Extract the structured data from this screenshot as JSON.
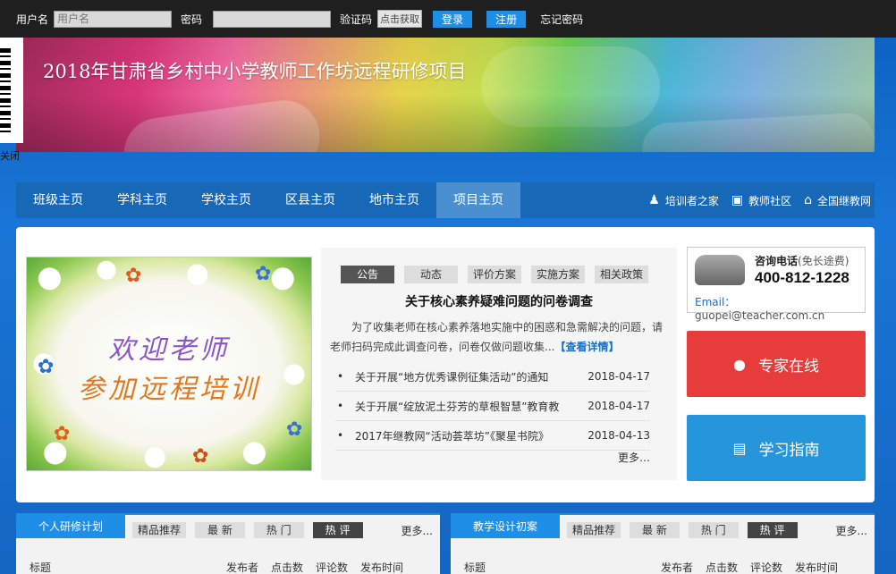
{
  "login": {
    "username_label": "用户名",
    "username_placeholder": "用户名",
    "password_label": "密码",
    "captcha_label": "验证码",
    "captcha_button": "点击获取",
    "login_button": "登录",
    "register_button": "注册",
    "forgot_link": "忘记密码"
  },
  "banner": {
    "title": "2018年甘肃省乡村中小学教师工作坊远程研修项目"
  },
  "qr": {
    "close_label": "关闭"
  },
  "nav": {
    "items": [
      "班级主页",
      "学科主页",
      "学校主页",
      "区县主页",
      "地市主页",
      "项目主页"
    ],
    "active_index": 5,
    "right_links": [
      "培训者之家",
      "教师社区",
      "全国继教网"
    ]
  },
  "welcome": {
    "line1": "欢迎老师",
    "line2": "参加远程培训"
  },
  "notice": {
    "tabs": [
      "公告",
      "动态",
      "评价方案",
      "实施方案",
      "相关政策"
    ],
    "headline": "关于核心素养疑难问题的问卷调查",
    "summary": "为了收集老师在核心素养落地实施中的困惑和急需解决的问题，请老师扫码完成此调查问卷，问卷仅做问题收集...",
    "detail_link": "【查看详情】",
    "items": [
      {
        "title": "关于开展“地方优秀课例征集活动”的通知",
        "date": "2018-04-17"
      },
      {
        "title": "关于开展“绽放泥土芬芳的草根智慧”教育教",
        "date": "2018-04-17"
      },
      {
        "title": "2017年继教网“活动荟萃坊”《聚星书院》",
        "date": "2018-04-13"
      }
    ],
    "more": "更多…"
  },
  "contact": {
    "label": "咨询电话",
    "note": "(免长途费)",
    "phone": "400-812-1228",
    "email_label": "Email：",
    "email": "guopei@teacher.com.cn"
  },
  "buttons": {
    "expert": "专家在线",
    "guide": "学习指南"
  },
  "sections": [
    {
      "title": "个人研修计划",
      "tabs": [
        "精品推荐",
        "最 新",
        "热 门",
        "热 评"
      ],
      "active_index": 3,
      "more": "更多...",
      "columns": [
        "标题",
        "发布者",
        "点击数",
        "评论数",
        "发布时间"
      ]
    },
    {
      "title": "教学设计初案",
      "tabs": [
        "精品推荐",
        "最 新",
        "热 门",
        "热 评"
      ],
      "active_index": 3,
      "more": "更多...",
      "columns": [
        "标题",
        "发布者",
        "点击数",
        "评论数",
        "发布时间"
      ]
    }
  ],
  "colors": {
    "topbar": "#1f1f1f",
    "nav": "#1769b8",
    "accent_blue": "#1e8ee6",
    "expert_red": "#e73c3c",
    "guide_blue": "#2596dc"
  },
  "icons": {
    "trainer": "person-icon",
    "community": "monitor-icon",
    "national": "house-icon",
    "expert": "user-icon",
    "guide": "document-icon",
    "phone": "telephone-icon"
  }
}
